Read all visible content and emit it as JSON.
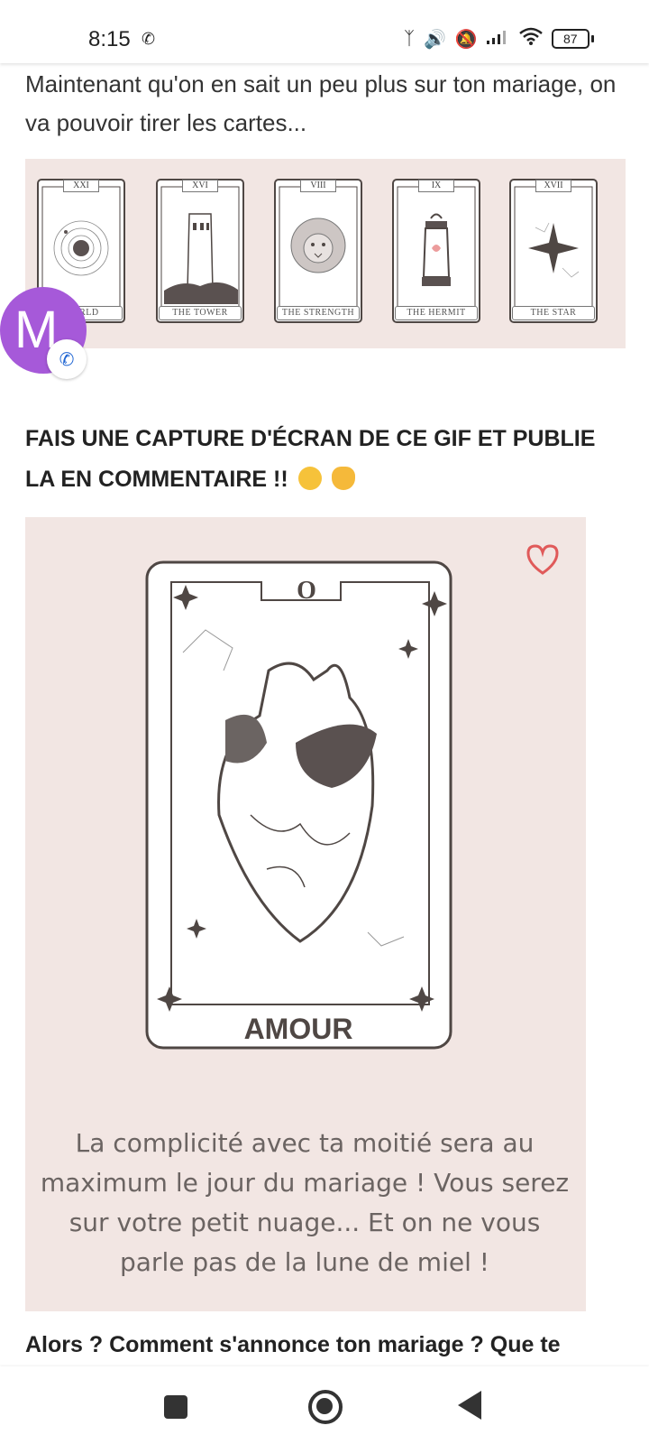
{
  "status_bar": {
    "time": "8:15",
    "battery": "87"
  },
  "post": {
    "intro": "Maintenant qu'on en sait un peu plus sur ton mariage, on va pouvoir tirer les cartes...",
    "tarot_cards": [
      {
        "number": "XXI",
        "label": "WORLD"
      },
      {
        "number": "XVI",
        "label": "THE TOWER"
      },
      {
        "number": "VIII",
        "label": "THE STRENGTH"
      },
      {
        "number": "IX",
        "label": "THE HERMIT"
      },
      {
        "number": "XVII",
        "label": "THE STAR"
      }
    ],
    "avatar_letter": "M",
    "heading": "FAIS UNE CAPTURE D'ÉCRAN DE CE GIF ET PUBLIE LA EN COMMENTAIRE !!",
    "big_card": {
      "number": "O",
      "title": "AMOUR",
      "text": "La complicité avec ta moitié sera au maximum le jour du mariage ! Vous serez sur votre petit nuage... Et on ne vous parle pas de la lune de miel !"
    },
    "closing": "Alors ? Comment s'annonce ton mariage ? Que te"
  },
  "colors": {
    "card_bg": "#f2e6e3",
    "avatar": "#a659d9",
    "heart": "#e05a5a",
    "ink": "#4f4744"
  },
  "icons": [
    "phone-icon",
    "bluetooth-icon",
    "volume-icon",
    "mute-icon",
    "signal-icon",
    "wifi-icon",
    "battery-icon",
    "heart-icon",
    "call-icon"
  ]
}
